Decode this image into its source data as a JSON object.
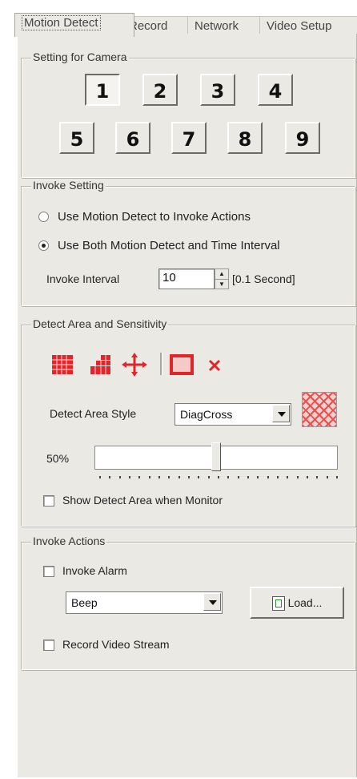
{
  "tabs": [
    {
      "label": "Motion Detect",
      "active": true
    },
    {
      "label": "Record",
      "active": false
    },
    {
      "label": "Network",
      "active": false
    },
    {
      "label": "Video Setup",
      "active": false
    }
  ],
  "camera_group": {
    "title": "Setting for Camera",
    "cameras": [
      "1",
      "2",
      "3",
      "4",
      "5",
      "6",
      "7",
      "8",
      "9"
    ],
    "selected": "1"
  },
  "invoke_setting": {
    "title": "Invoke Setting",
    "option_motion": "Use Motion Detect to Invoke Actions",
    "option_both": "Use Both Motion Detect and Time Interval",
    "selected": "option_both",
    "interval_label": "Invoke Interval",
    "interval_value": "10",
    "interval_unit": "[0.1 Second]"
  },
  "detect_area": {
    "title": "Detect Area and Sensitivity",
    "tools": [
      "grid-fill-icon",
      "grid-partial-icon",
      "move-cross-icon",
      "square-outline-icon",
      "delete-x-icon"
    ],
    "style_label": "Detect Area Style",
    "style_value": "DiagCross",
    "sensitivity_label": "50%",
    "sensitivity_fraction": 0.5,
    "show_area_label": "Show Detect Area when Monitor",
    "show_area_checked": false,
    "accent_color": "#e0262a"
  },
  "invoke_actions": {
    "title": "Invoke Actions",
    "alarm_label": "Invoke Alarm",
    "alarm_checked": false,
    "sound_value": "Beep",
    "load_label": "Load...",
    "record_label": "Record Video Stream",
    "record_checked": false
  }
}
